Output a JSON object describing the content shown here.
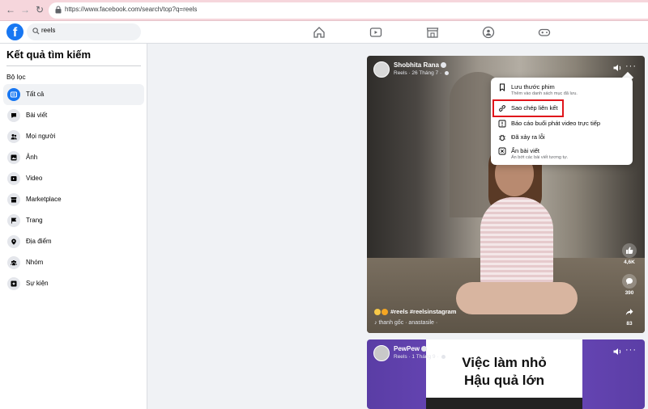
{
  "browser": {
    "url": "https://www.facebook.com/search/top?q=reels"
  },
  "topbar": {
    "search_value": "reels"
  },
  "sidebar": {
    "title": "Kết quả tìm kiếm",
    "filter_label": "Bộ lọc",
    "items": [
      {
        "label": "Tất cả",
        "icon": "all-results-icon",
        "active": true
      },
      {
        "label": "Bài viết",
        "icon": "posts-icon"
      },
      {
        "label": "Mọi người",
        "icon": "people-icon"
      },
      {
        "label": "Ảnh",
        "icon": "photos-icon"
      },
      {
        "label": "Video",
        "icon": "video-icon"
      },
      {
        "label": "Marketplace",
        "icon": "marketplace-icon"
      },
      {
        "label": "Trang",
        "icon": "pages-flag-icon"
      },
      {
        "label": "Địa điểm",
        "icon": "location-pin-icon"
      },
      {
        "label": "Nhóm",
        "icon": "groups-icon"
      },
      {
        "label": "Sự kiện",
        "icon": "events-star-icon"
      }
    ]
  },
  "reel1": {
    "author": "Shobhita Rana",
    "meta": "Reels · 26 Tháng 7 ·",
    "hashtags": "#reels #reelsinstagram",
    "audio": "thanh gốc · anastasile ·",
    "likes": "4,6K",
    "comments": "390",
    "shares": "83"
  },
  "reel2": {
    "author": "PewPew",
    "meta": "Reels · 1 Tháng 9 ·",
    "thumb_line1": "Việc làm nhỏ",
    "thumb_line2": "Hậu quả lớn"
  },
  "context_menu": {
    "items": [
      {
        "label": "Lưu thước phim",
        "sub": "Thêm vào danh sách mục đã lưu.",
        "icon": "bookmark-icon"
      },
      {
        "label": "Sao chép liên kết",
        "sub": "",
        "icon": "link-icon"
      },
      {
        "label": "Báo cáo buổi phát video trực tiếp",
        "sub": "",
        "icon": "report-flag-icon"
      },
      {
        "label": "Đã xảy ra lỗi",
        "sub": "",
        "icon": "bug-icon"
      },
      {
        "label": "Ẩn bài viết",
        "sub": "Ẩn bớt các bài viết tương tự.",
        "icon": "hide-x-icon"
      }
    ]
  },
  "colors": {
    "brand": "#1877f2",
    "highlight": "#e0151b"
  }
}
